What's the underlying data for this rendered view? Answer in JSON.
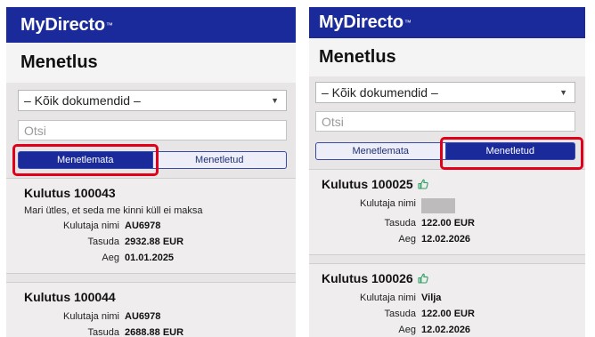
{
  "brand": "MyDirecto",
  "page_title": "Menetlus",
  "filter": {
    "selected": "– Kõik dokumendid –"
  },
  "search": {
    "placeholder": "Otsi"
  },
  "tabs": [
    "Menetlemata",
    "Menetletud"
  ],
  "left_panel": {
    "active_tab": "Menetlemata",
    "cards": [
      {
        "title": "Kulutus 100043",
        "note": "Mari ütles, et seda me kinni küll ei maksa",
        "fields": [
          {
            "label": "Kulutaja nimi",
            "value": "AU6978"
          },
          {
            "label": "Tasuda",
            "value": "2932.88 EUR"
          },
          {
            "label": "Aeg",
            "value": "01.01.2025"
          }
        ]
      },
      {
        "title": "Kulutus 100044",
        "fields": [
          {
            "label": "Kulutaja nimi",
            "value": "AU6978"
          },
          {
            "label": "Tasuda",
            "value": "2688.88 EUR"
          }
        ]
      }
    ]
  },
  "right_panel": {
    "active_tab": "Menetletud",
    "cards": [
      {
        "title": "Kulutus 100025",
        "thumb_icon": "thumbs-up-icon",
        "fields": [
          {
            "label": "Kulutaja nimi",
            "value": ""
          },
          {
            "label": "Tasuda",
            "value": "122.00 EUR"
          },
          {
            "label": "Aeg",
            "value": "12.02.2026"
          }
        ]
      },
      {
        "title": "Kulutus 100026",
        "thumb_icon": "thumbs-up-icon",
        "fields": [
          {
            "label": "Kulutaja nimi",
            "value": "Vilja"
          },
          {
            "label": "Tasuda",
            "value": "122.00 EUR"
          },
          {
            "label": "Aeg",
            "value": "12.02.2026"
          }
        ]
      }
    ]
  },
  "colors": {
    "brand_bar": "#1a2a9a",
    "active_tab": "#1a2a9a",
    "highlight": "#e0001a",
    "thumb_icon": "#2aa060"
  }
}
